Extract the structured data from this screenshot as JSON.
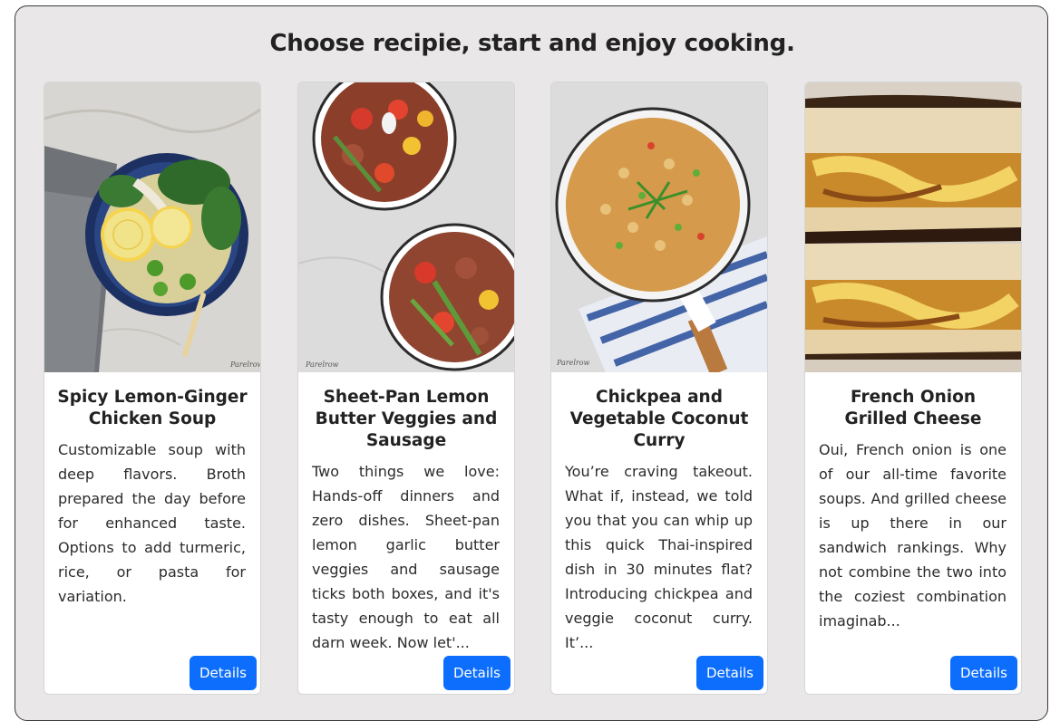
{
  "page": {
    "heading": "Choose recipie, start and enjoy cooking."
  },
  "cards": [
    {
      "title": "Spicy Lemon-Ginger Chicken Soup",
      "description": "Customizable soup with deep flavors. Broth prepared the day before for enhanced taste. Options to add turmeric, rice, or pasta for variation.",
      "button_label": "Details",
      "image_watermark": "Parelrow",
      "image_icon": "lemon-chicken-soup-image"
    },
    {
      "title": "Sheet-Pan Lemon Butter Veggies and Sausage",
      "description": "Two things we love: Hands-off dinners and zero dishes. Sheet-pan lemon garlic butter veggies and sausage ticks both boxes, and it's tasty enough to eat all darn week. Now let'...",
      "button_label": "Details",
      "image_watermark": "Parelrow",
      "image_icon": "veggies-sausage-image"
    },
    {
      "title": "Chickpea and Vegetable Coconut Curry",
      "description": "You’re craving takeout. What if, instead, we told you that you can whip up this quick Thai-inspired dish in 30 minutes flat? Introducing chickpea and veggie coconut curry. It’...",
      "button_label": "Details",
      "image_watermark": "Parelrow",
      "image_icon": "chickpea-curry-image"
    },
    {
      "title": "French Onion Grilled Cheese",
      "description": "Oui, French onion is one of our all-time favorite soups. And grilled cheese is up there in our sandwich rankings. Why not combine the two into the coziest combination imaginab...",
      "button_label": "Details",
      "image_icon": "grilled-cheese-image"
    }
  ],
  "colors": {
    "panel_background": "#e9e7e7",
    "button": "#0d6efd",
    "card_background": "#ffffff"
  }
}
